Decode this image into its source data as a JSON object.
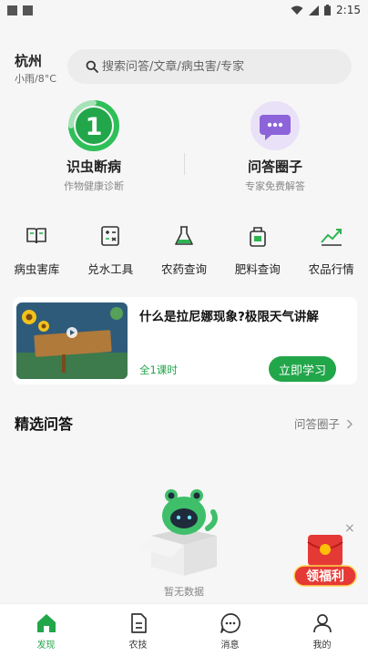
{
  "status_bar": {
    "time": "2:15"
  },
  "header": {
    "city": "杭州",
    "weather": "小雨/8°C",
    "search_placeholder": "搜索问答/文章/病虫害/专家"
  },
  "features": [
    {
      "title": "识虫断病",
      "subtitle": "作物健康诊断",
      "badge": "1"
    },
    {
      "title": "问答圈子",
      "subtitle": "专家免费解答"
    }
  ],
  "tools": [
    {
      "label": "病虫害库",
      "icon": "book-icon"
    },
    {
      "label": "兑水工具",
      "icon": "calculator-icon"
    },
    {
      "label": "农药查询",
      "icon": "flask-icon"
    },
    {
      "label": "肥料查询",
      "icon": "fertilizer-icon"
    },
    {
      "label": "农品行情",
      "icon": "trend-chart-icon"
    }
  ],
  "course": {
    "title": "什么是拉尼娜现象?极限天气讲解",
    "lesson_count": "全1课时",
    "button": "立即学习"
  },
  "section": {
    "title": "精选问答",
    "link": "问答圈子"
  },
  "empty_state": {
    "text": "暂无数据"
  },
  "promo": {
    "label": "领福利"
  },
  "tabs": [
    {
      "label": "发现",
      "icon": "home-icon",
      "active": true
    },
    {
      "label": "农技",
      "icon": "document-icon"
    },
    {
      "label": "消息",
      "icon": "chat-icon"
    },
    {
      "label": "我的",
      "icon": "user-icon"
    }
  ],
  "colors": {
    "accent": "#22a64a",
    "background": "#f6f6f6",
    "promo_red": "#e53935"
  }
}
